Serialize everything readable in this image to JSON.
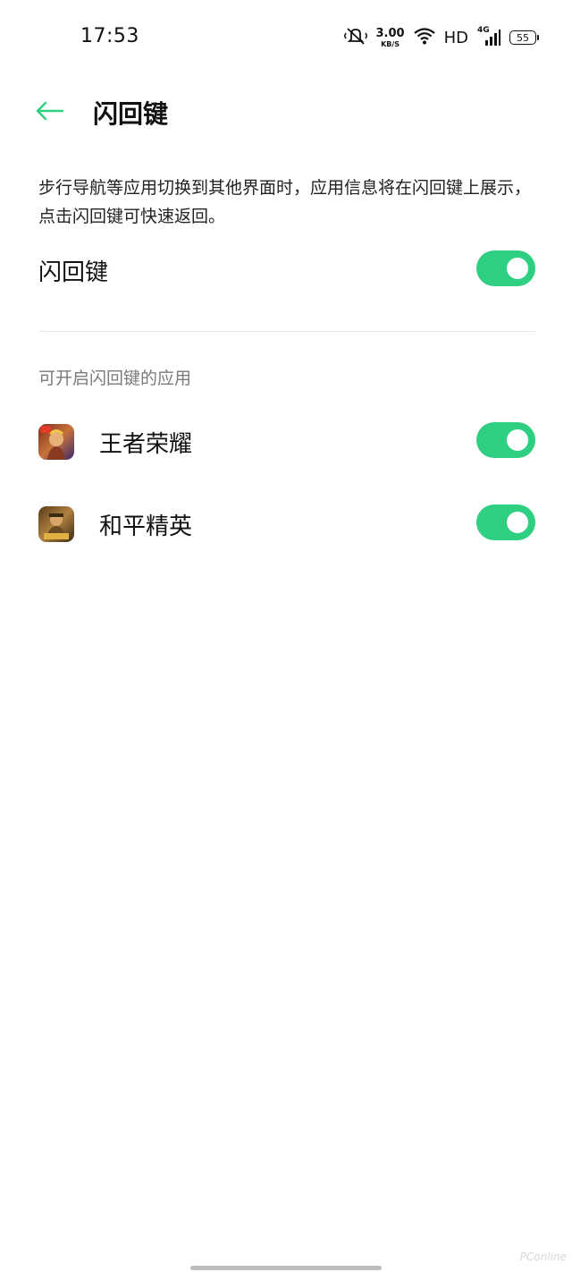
{
  "status_bar": {
    "time": "17:53",
    "icons": [
      "mute-vibrate-icon",
      "net-speed",
      "wifi-icon",
      "hd-indicator",
      "signal-4g-icon",
      "battery-icon"
    ],
    "net_speed_value": "3.00",
    "net_speed_unit": "KB/S",
    "hd": "HD",
    "network_type": "4G",
    "battery_level": "55"
  },
  "header": {
    "back_icon": "arrow-left-icon",
    "title": "闪回键"
  },
  "description": "步行导航等应用切换到其他界面时，应用信息将在闪回键上展示，点击闪回键可快速返回。",
  "master_toggle": {
    "label": "闪回键",
    "enabled": true
  },
  "apps_section": {
    "title": "可开启闪回键的应用",
    "apps": [
      {
        "name": "王者荣耀",
        "icon": "honor-of-kings-icon",
        "enabled": true
      },
      {
        "name": "和平精英",
        "icon": "game-for-peace-icon",
        "enabled": true
      }
    ]
  },
  "watermark": "PConline",
  "colors": {
    "accent": "#2ecf81",
    "text_primary": "#111111",
    "text_secondary": "#7a7a7a",
    "divider": "#e6e6e6"
  }
}
